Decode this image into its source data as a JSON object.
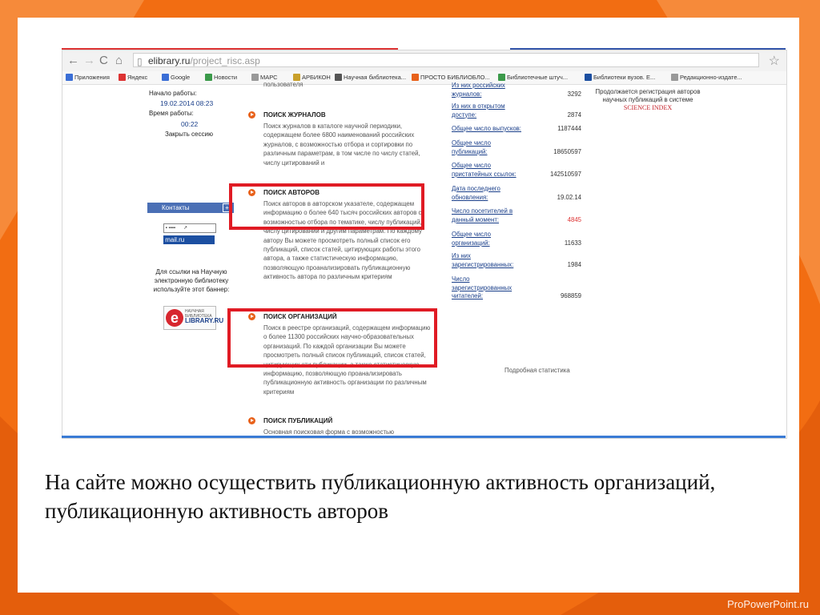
{
  "browser": {
    "url_host": "elibrary.ru",
    "url_path": "/project_risc.asp",
    "bookmarks": [
      {
        "label": "Приложения",
        "color": "#3b6fd6"
      },
      {
        "label": "Яндекс",
        "color": "#d33"
      },
      {
        "label": "Google",
        "color": "#3b6fd6"
      },
      {
        "label": "Новости",
        "color": "#3b9a4a"
      },
      {
        "label": "МАРС",
        "color": "#999"
      },
      {
        "label": "АРБИКОН",
        "color": "#c9a02a"
      },
      {
        "label": "Научная библиотека...",
        "color": "#555"
      },
      {
        "label": "ПРОСТО БИБЛИОБЛО...",
        "color": "#e8611a"
      },
      {
        "label": "Библиотечные штуч...",
        "color": "#3b9a4a"
      },
      {
        "label": "Библиотеки вузов. Е...",
        "color": "#1c4fa1"
      },
      {
        "label": "Редакционно-издате...",
        "color": "#999"
      }
    ]
  },
  "sidebar": {
    "start_label": "Начало работы:",
    "start_value": "19.02.2014 08:23",
    "time_label": "Время работы:",
    "time_value": "00:22",
    "close_session": "Закрыть сессию",
    "contacts": "Контакты",
    "counter_mail": "mail.ru",
    "banner_text": "Для ссылки на Научную электронную библиотеку используйте этот баннер:",
    "banner_small": "НАУЧНАЯ БИБЛИОТЕКА",
    "banner_name": "LIBRARY.RU"
  },
  "sections": {
    "top_fragment": "пользователя",
    "journals": {
      "title": "ПОИСК ЖУРНАЛОВ",
      "desc": "Поиск журналов в каталоге научной периодики, содержащем более 6800 наименований российских журналов, с возможностью отбора и сортировки по различным параметрам, в том числе по числу статей, числу цитирований и"
    },
    "authors": {
      "title": "ПОИСК АВТОРОВ",
      "desc": "Поиск авторов в авторском указателе, содержащем информацию о более 640 тысяч российских авторов с возможностью отбора по тематике, числу публикаций, числу цитирований и другим параметрам. По каждому автору Вы можете просмотреть полный список его публикаций, список статей, цитирующих работы этого автора, а также статистическую информацию, позволяющую проанализировать публикационную активность автора по различным критериям"
    },
    "orgs": {
      "title": "ПОИСК ОРГАНИЗАЦИЙ",
      "desc": "Поиск в реестре организаций, содержащем информацию о более 11300 российских научно-образовательных организаций. По каждой организации Вы можете просмотреть полный список публикаций, список статей, цитирующих эти публикации, а также статистическую информацию, позволяющую проанализировать публикационную активность организации по различным критериям"
    },
    "pubs": {
      "title": "ПОИСК ПУБЛИКАЦИЙ",
      "desc": "Основная поисковая форма с возможностью"
    }
  },
  "stats": [
    {
      "label": "Из них российских\nжурналов:",
      "value": "3292",
      "color": "#333"
    },
    {
      "label": "Из них в открытом\nдоступе:",
      "value": "2874",
      "color": "#333"
    },
    {
      "label": "Общее число выпусков:",
      "value": "1187444",
      "color": "#333"
    },
    {
      "label": "Общее число\nпубликаций:",
      "value": "18650597",
      "color": "#333"
    },
    {
      "label": "Общее число\nпристатейных ссылок:",
      "value": "142510597",
      "color": "#333"
    },
    {
      "label": "Дата последнего\nобновления:",
      "value": "19.02.14",
      "color": "#333"
    },
    {
      "label": "Число посетителей в\nданный момент:",
      "value": "4845",
      "color": "#d33"
    },
    {
      "label": "Общее число\nорганизаций:",
      "value": "11633",
      "color": "#333"
    },
    {
      "label": "Из них\nзарегистрированных:",
      "value": "1984",
      "color": "#333"
    },
    {
      "label": "Число\nзарегистрированных\nчитателей:",
      "value": "968859",
      "color": "#333"
    }
  ],
  "stats_link": "Подробная статистика",
  "registration": {
    "text": "Продолжается регистрация авторов научных публикаций в системе",
    "index": "SCIENCE INDEX"
  },
  "caption": "На сайте можно осуществить публикационную активность организаций, публикационную активность авторов",
  "brand": "ProPowerPoint.ru",
  "colors": {
    "highlight": "#e01b24",
    "accent": "#f26d12"
  }
}
